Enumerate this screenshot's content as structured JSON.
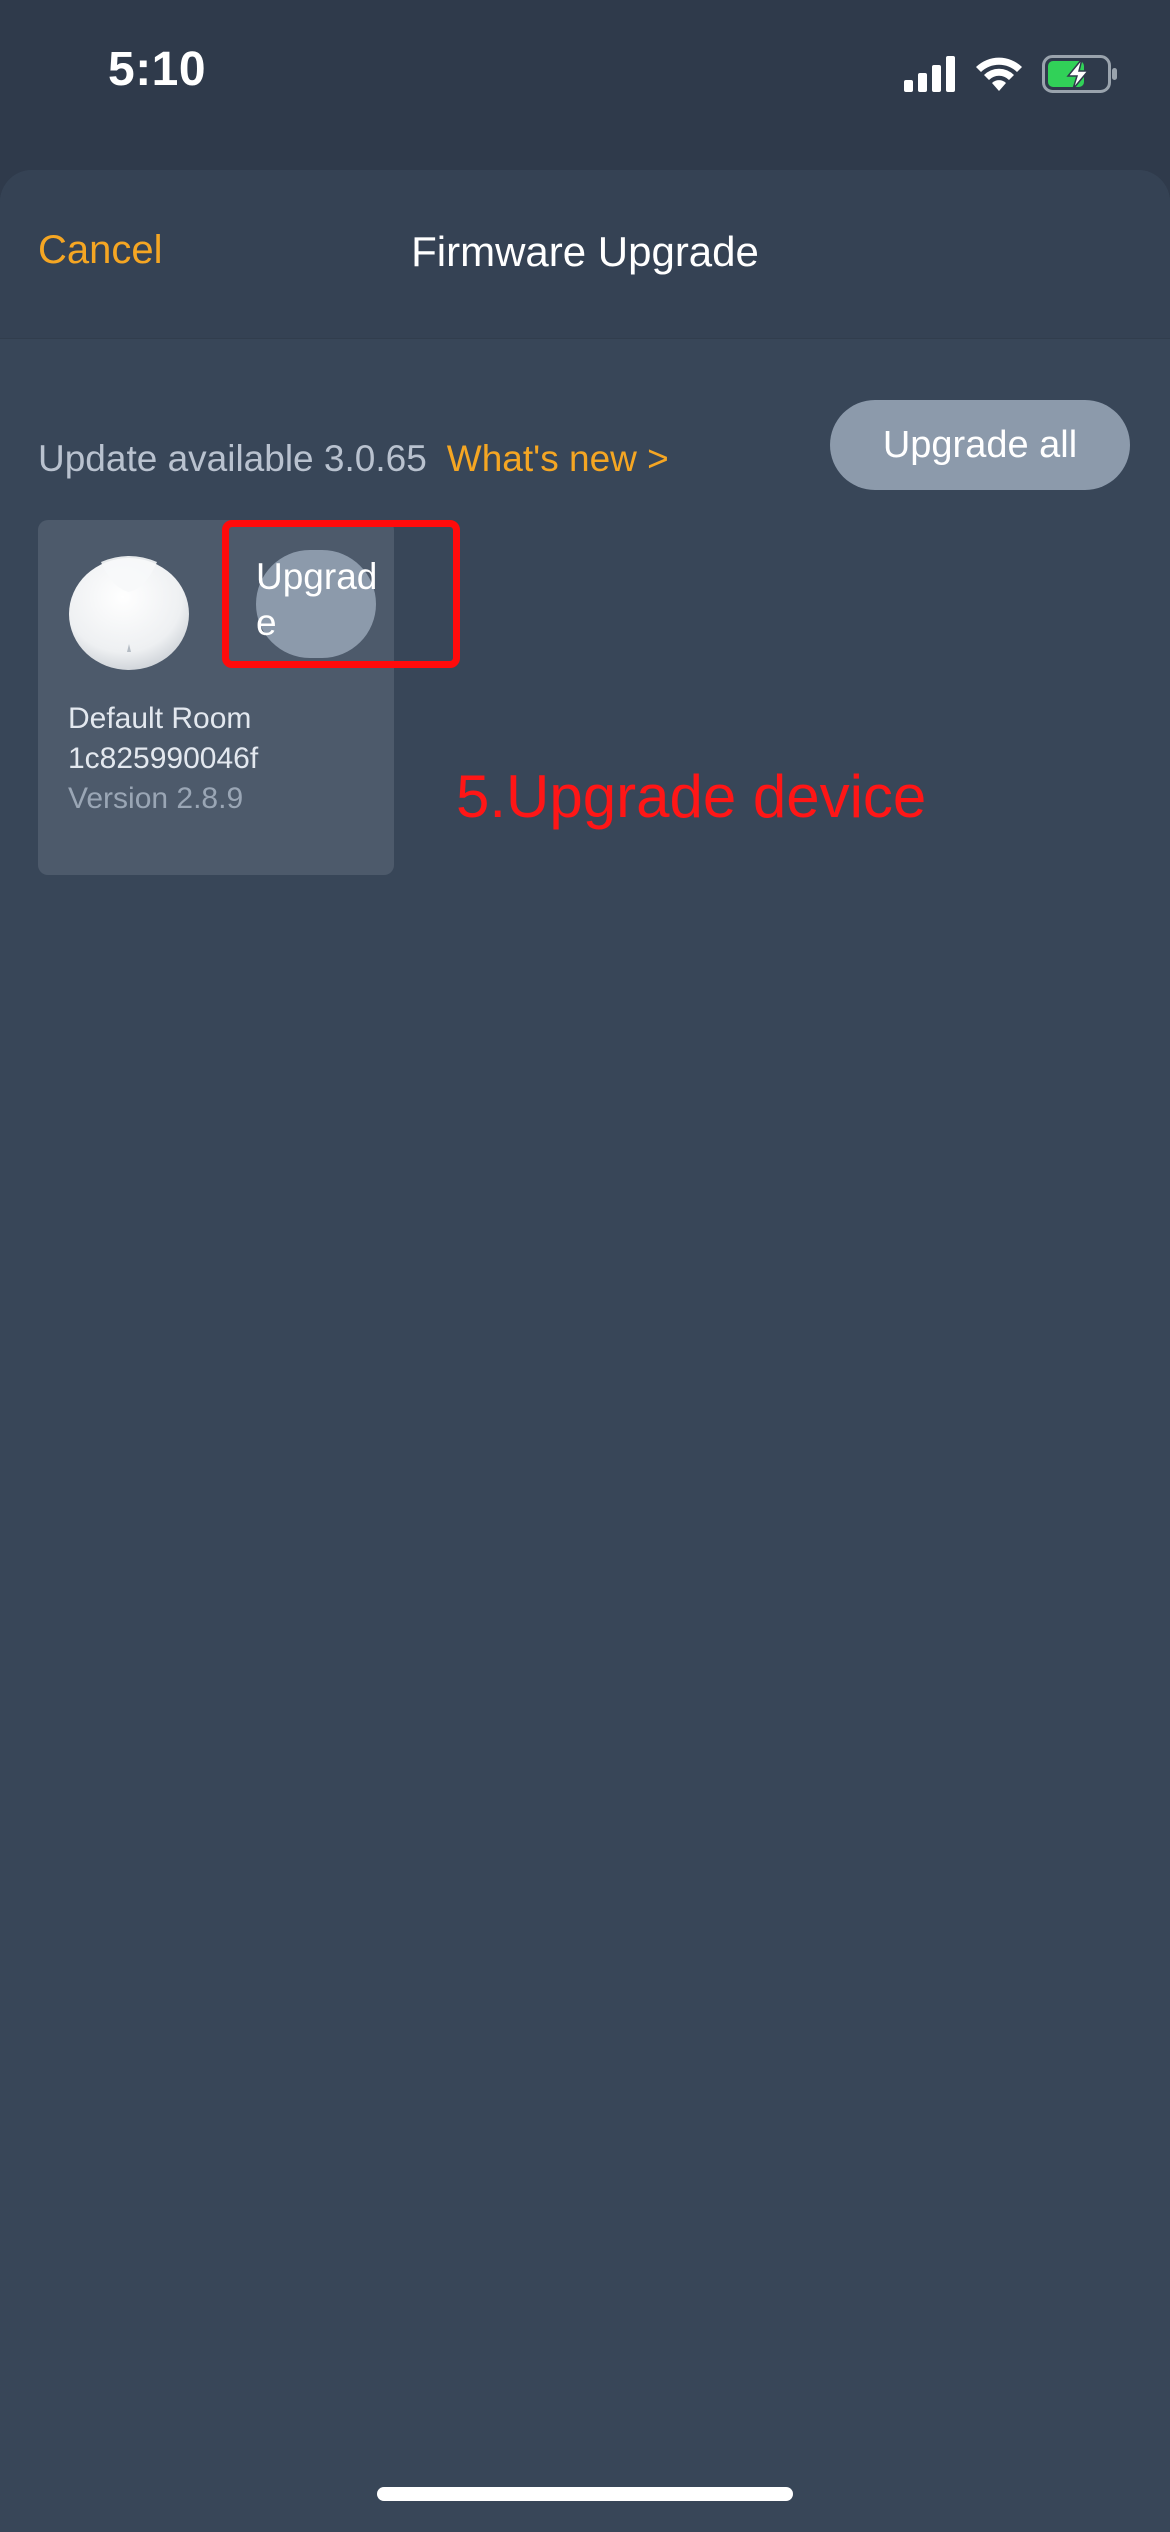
{
  "status_bar": {
    "time": "5:10",
    "icons": [
      "signal-icon",
      "wifi-icon",
      "battery-charging-icon"
    ]
  },
  "nav": {
    "cancel_label": "Cancel",
    "title": "Firmware Upgrade"
  },
  "update": {
    "available_text": "Update available 3.0.65",
    "whats_new_label": "What's new >",
    "upgrade_all_label": "Upgrade all"
  },
  "devices": [
    {
      "room": "Default Room",
      "id": "1c825990046f",
      "version": "Version 2.8.9",
      "upgrade_label": "Upgrade"
    }
  ],
  "annotation": {
    "text": "5.Upgrade device"
  },
  "colors": {
    "accent": "#f5a623",
    "background": "#384658",
    "button": "#8c9aab",
    "annotation_red": "#ff1616"
  }
}
